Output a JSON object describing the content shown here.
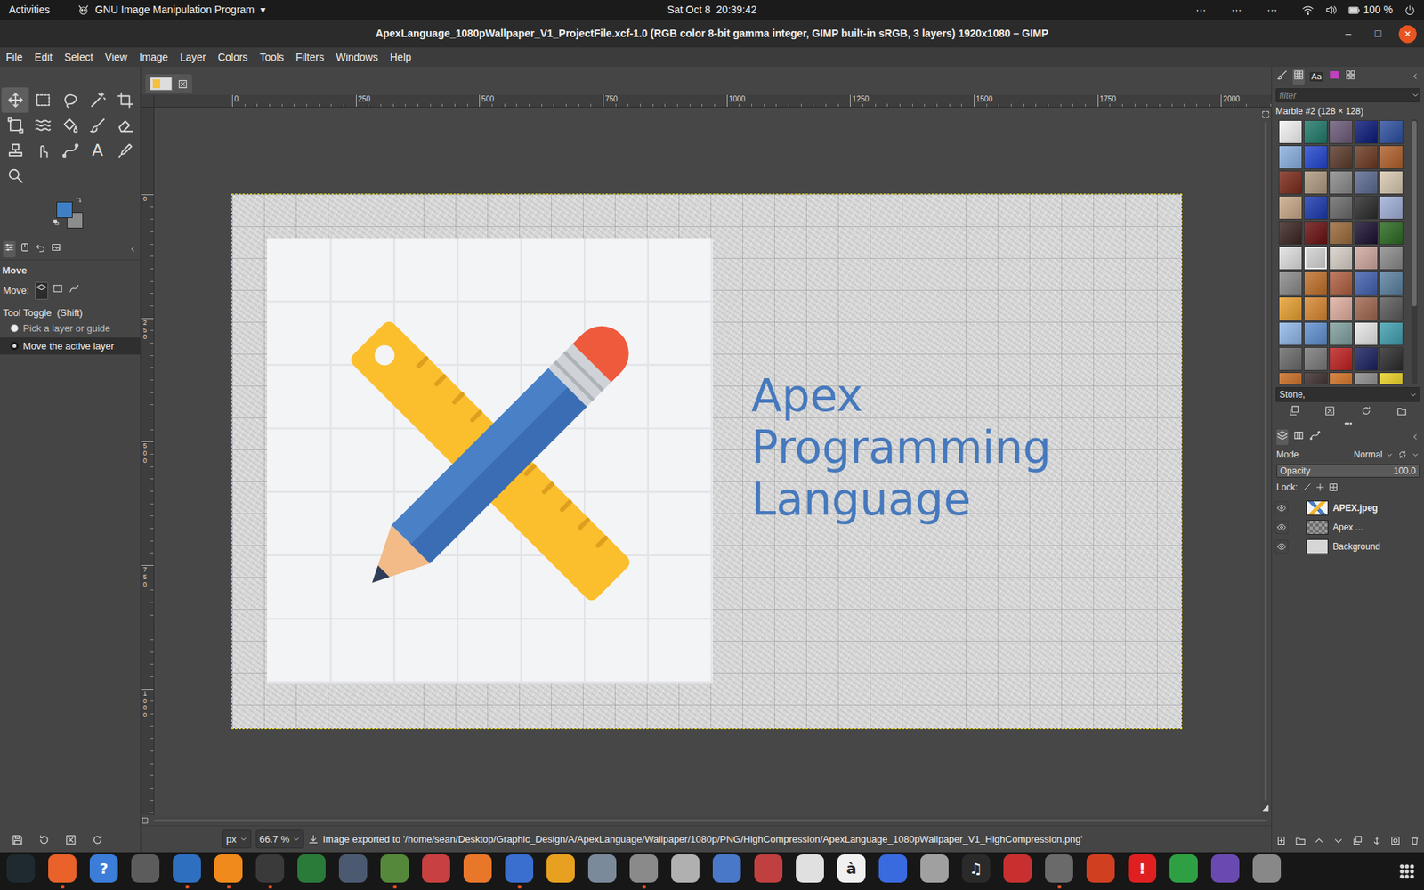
{
  "top_bar": {
    "activities": "Activities",
    "app_menu": "GNU Image Manipulation Program",
    "app_menu_arrow": "▾",
    "clock": "Sat Oct 8  20:39:42",
    "indicators": [
      "···",
      "···",
      "···"
    ],
    "battery": "100 %"
  },
  "window": {
    "title": "ApexLanguage_1080pWallpaper_V1_ProjectFile.xcf-1.0 (RGB color 8-bit gamma integer, GIMP built-in sRGB, 3 layers) 1920x1080 – GIMP",
    "controls": [
      "–",
      "□",
      "✕"
    ]
  },
  "menu": [
    "File",
    "Edit",
    "Select",
    "View",
    "Image",
    "Layer",
    "Colors",
    "Tools",
    "Filters",
    "Windows",
    "Help"
  ],
  "toolbox": {
    "tools": [
      {
        "kind": "move",
        "selected": true
      },
      {
        "kind": "rect-select",
        "selected": false
      },
      {
        "kind": "free-select",
        "selected": false
      },
      {
        "kind": "fuzzy-select",
        "selected": false
      },
      {
        "kind": "crop",
        "selected": false
      },
      {
        "kind": "transform",
        "selected": false
      },
      {
        "kind": "warp",
        "selected": false
      },
      {
        "kind": "bucket",
        "selected": false
      },
      {
        "kind": "paintbrush",
        "selected": false
      },
      {
        "kind": "eraser",
        "selected": false
      },
      {
        "kind": "clone",
        "selected": false
      },
      {
        "kind": "smudge",
        "selected": false
      },
      {
        "kind": "paths",
        "selected": false
      },
      {
        "kind": "text",
        "label": "A",
        "selected": false
      },
      {
        "kind": "picker",
        "selected": false
      },
      {
        "kind": "zoom",
        "selected": false
      }
    ],
    "foreground": "#3f80c4",
    "background": "#8c8c8c"
  },
  "tool_options": {
    "tabs": [
      {
        "kind": "options",
        "selected": true
      },
      {
        "kind": "device",
        "selected": false
      },
      {
        "kind": "undo",
        "selected": false
      },
      {
        "kind": "images",
        "selected": false
      }
    ],
    "title": "Move",
    "move_label": "Move:",
    "move_modes": [
      {
        "kind": "layer",
        "selected": true
      },
      {
        "kind": "selection",
        "selected": false
      },
      {
        "kind": "path",
        "selected": false
      }
    ],
    "toggle_label": "Tool Toggle  (Shift)",
    "options": [
      {
        "label": "Pick a layer or guide",
        "selected": false
      },
      {
        "label": "Move the active layer",
        "selected": true
      }
    ]
  },
  "rulers": {
    "horizontal": [
      "0",
      "250",
      "500",
      "750",
      "1000",
      "1250",
      "1500",
      "1750",
      "2000"
    ],
    "vertical": [
      "0",
      "250",
      "500",
      "750",
      "1000"
    ]
  },
  "image": {
    "text_lines": [
      "Apex",
      "Programming",
      "Language"
    ]
  },
  "status_bar": {
    "unit": "px",
    "zoom": "66.7 %",
    "message": "Image exported to '/home/sean/Desktop/Graphic_Design/A/ApexLanguage/Wallpaper/1080p/PNG/HighCompression/ApexLanguage_1080pWallpaper_V1_HighCompression.png'"
  },
  "patterns": {
    "tabs": [
      {
        "kind": "brushes",
        "selected": false
      },
      {
        "kind": "patterns",
        "selected": true
      },
      {
        "kind": "fonts",
        "label": "Aa",
        "selected": false
      },
      {
        "kind": "gradients",
        "selected": false
      },
      {
        "kind": "palettes",
        "selected": false
      }
    ],
    "filter_placeholder": "filter",
    "current": "Marble #2 (128 × 128)",
    "tag": "Stone,",
    "swatches": [
      {
        "color": "#f4f4f4",
        "selected": false
      },
      {
        "color": "#1f7a6a",
        "selected": false
      },
      {
        "color": "#6b5a78",
        "selected": false
      },
      {
        "color": "#0a1a7a",
        "selected": false
      },
      {
        "color": "#2c4fa0",
        "selected": false
      },
      {
        "color": "#8ab0e0",
        "selected": false
      },
      {
        "color": "#2246d0",
        "selected": false
      },
      {
        "color": "#5a3a2a",
        "selected": false
      },
      {
        "color": "#6b3a22",
        "selected": false
      },
      {
        "color": "#b0602a",
        "selected": false
      },
      {
        "color": "#7a2a1a",
        "selected": false
      },
      {
        "color": "#b09a80",
        "selected": false
      },
      {
        "color": "#8a8a8a",
        "selected": false
      },
      {
        "color": "#5a6a90",
        "selected": false
      },
      {
        "color": "#d8c8b0",
        "selected": false
      },
      {
        "color": "#c8a888",
        "selected": false
      },
      {
        "color": "#1a3ab0",
        "selected": false
      },
      {
        "color": "#6a6a6a",
        "selected": false
      },
      {
        "color": "#2a2a2a",
        "selected": false
      },
      {
        "color": "#a0b0d8",
        "selected": false
      },
      {
        "color": "#3a2420",
        "selected": false
      },
      {
        "color": "#6a1010",
        "selected": false
      },
      {
        "color": "#9a6a3a",
        "selected": false
      },
      {
        "color": "#1a1030",
        "selected": false
      },
      {
        "color": "#2a6a20",
        "selected": false
      },
      {
        "color": "#e0e0e0",
        "selected": false
      },
      {
        "color": "#d4d4d4",
        "selected": true
      },
      {
        "color": "#d8d0c8",
        "selected": false
      },
      {
        "color": "#d0a8a0",
        "selected": false
      },
      {
        "color": "#8a8a8a",
        "selected": false
      },
      {
        "color": "#8a8a8a",
        "selected": false
      },
      {
        "color": "#c0702a",
        "selected": false
      },
      {
        "color": "#b06040",
        "selected": false
      },
      {
        "color": "#4060b0",
        "selected": false
      },
      {
        "color": "#5a80a0",
        "selected": false
      },
      {
        "color": "#e8a030",
        "selected": false
      },
      {
        "color": "#d88830",
        "selected": false
      },
      {
        "color": "#e0b0a0",
        "selected": false
      },
      {
        "color": "#a06850",
        "selected": false
      },
      {
        "color": "#5a5a5a",
        "selected": false
      },
      {
        "color": "#90b8e8",
        "selected": false
      },
      {
        "color": "#6090d0",
        "selected": false
      },
      {
        "color": "#80a0a0",
        "selected": false
      },
      {
        "color": "#e8e8e8",
        "selected": false
      },
      {
        "color": "#40a0b0",
        "selected": false
      },
      {
        "color": "#6a6a6a",
        "selected": false
      },
      {
        "color": "#7a7a7a",
        "selected": false
      },
      {
        "color": "#c02020",
        "selected": false
      },
      {
        "color": "#1a2060",
        "selected": false
      },
      {
        "color": "#2a2a2a",
        "selected": false
      },
      {
        "color": "#c86a20",
        "selected": false
      },
      {
        "color": "#3a2a2a",
        "selected": false
      },
      {
        "color": "#d07020",
        "selected": false
      },
      {
        "color": "#8a8a8a",
        "selected": false
      },
      {
        "color": "#e8d020",
        "selected": false
      }
    ]
  },
  "layers": {
    "tabs": [
      {
        "kind": "layers",
        "selected": true
      },
      {
        "kind": "channels",
        "selected": false
      },
      {
        "kind": "paths",
        "selected": false
      }
    ],
    "mode_label": "Mode",
    "mode": "Normal",
    "opacity_label": "Opacity",
    "opacity": "100.0",
    "opacity_level": 1.0,
    "lock_label": "Lock:",
    "items": [
      {
        "name": "APEX.jpeg",
        "kind": "image",
        "visible": true,
        "selected": true
      },
      {
        "name": "Apex ...",
        "kind": "text",
        "visible": true,
        "selected": false
      },
      {
        "name": "Background",
        "kind": "background",
        "visible": true,
        "selected": false
      }
    ]
  },
  "dock": [
    {
      "color": "#1f2a30",
      "running": false
    },
    {
      "color": "#e8622a",
      "running": true
    },
    {
      "color": "#3b7dd8",
      "glyph": "?",
      "running": false
    },
    {
      "color": "#5c5c5c",
      "running": false
    },
    {
      "color": "#2f6fc0",
      "running": true
    },
    {
      "color": "#f08a1c",
      "running": true
    },
    {
      "color": "#3a3a3a",
      "running": true
    },
    {
      "color": "#2a7a3a",
      "running": false
    },
    {
      "color": "#4b5a70",
      "running": false
    },
    {
      "color": "#55883a",
      "running": true
    },
    {
      "color": "#c84040",
      "running": false
    },
    {
      "color": "#e8772a",
      "running": false
    },
    {
      "color": "#3a6fd0",
      "running": true
    },
    {
      "color": "#e8a020",
      "running": false
    },
    {
      "color": "#7a8a9a",
      "running": false
    },
    {
      "color": "#8a8a8a",
      "running": true
    },
    {
      "color": "#b0b0b0",
      "running": false
    },
    {
      "color": "#4a78c8",
      "running": false
    },
    {
      "color": "#c04040",
      "running": false
    },
    {
      "color": "#e0e0e0",
      "running": false
    },
    {
      "color": "#f0f0f0",
      "glyph": "à",
      "running": false
    },
    {
      "color": "#3a6ae0",
      "running": false
    },
    {
      "color": "#a0a0a0",
      "running": false
    },
    {
      "color": "#2a2a2a",
      "glyph": "♫",
      "running": false
    },
    {
      "color": "#c83030",
      "running": false
    },
    {
      "color": "#6a6a6a",
      "running": true
    },
    {
      "color": "#d04020",
      "running": false
    },
    {
      "color": "#e02020",
      "glyph": "!",
      "running": false
    },
    {
      "color": "#2ea043",
      "running": false
    },
    {
      "color": "#6a4ab0",
      "running": false
    },
    {
      "color": "#888888",
      "running": false
    }
  ]
}
